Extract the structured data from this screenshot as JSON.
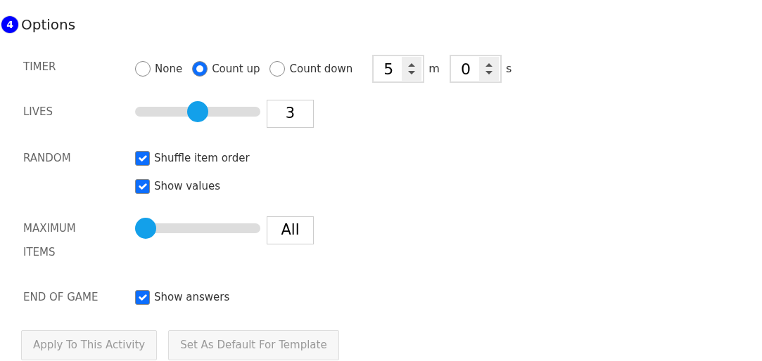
{
  "section": {
    "number": "4",
    "title": "Options"
  },
  "timer": {
    "label": "TIMER",
    "options": [
      {
        "label": "None",
        "selected": false
      },
      {
        "label": "Count up",
        "selected": true
      },
      {
        "label": "Count down",
        "selected": false
      }
    ],
    "minutes": {
      "value": "5",
      "unit": "m"
    },
    "seconds": {
      "value": "0",
      "unit": "s"
    }
  },
  "lives": {
    "label": "LIVES",
    "level": 0.5,
    "value": "3"
  },
  "random": {
    "label": "RANDOM",
    "options": [
      {
        "label": "Shuffle item order",
        "checked": true
      },
      {
        "label": "Show values",
        "checked": true
      }
    ]
  },
  "maximum_items": {
    "label": "MAXIMUM ITEMS",
    "level": 0,
    "value": "All"
  },
  "end_of_game": {
    "label": "END OF GAME",
    "options": [
      {
        "label": "Show answers",
        "checked": true
      }
    ]
  },
  "buttons": [
    {
      "label": "Apply To This Activity",
      "disabled": true
    },
    {
      "label": "Set As Default For Template",
      "disabled": true
    }
  ]
}
